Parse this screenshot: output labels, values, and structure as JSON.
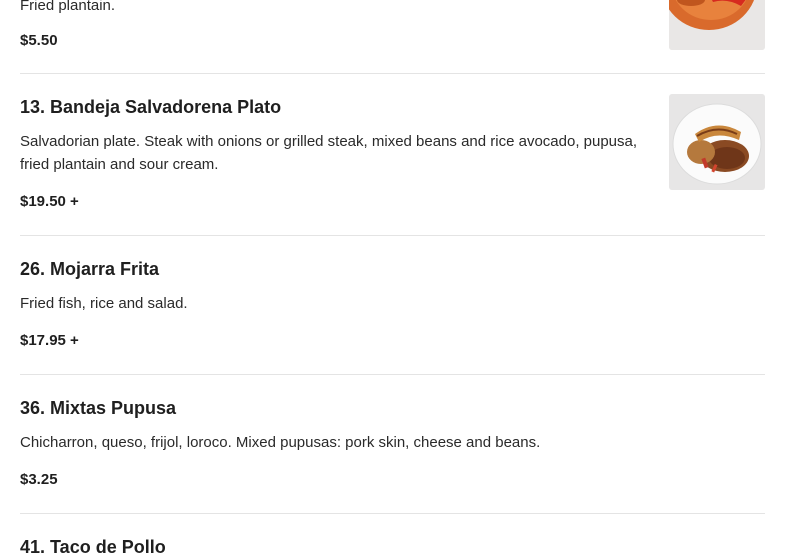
{
  "menu": {
    "items": [
      {
        "title": "",
        "description": "Fried plantain.",
        "price": "$5.50",
        "image": "plantain-dish-photo"
      },
      {
        "title": "13. Bandeja Salvadorena Plato",
        "description": "Salvadorian plate. Steak with onions or grilled steak, mixed beans and rice avocado, pupusa, fried plantain and sour cream.",
        "price": "$19.50 +",
        "image": "bandeja-plate-photo"
      },
      {
        "title": "26. Mojarra Frita",
        "description": "Fried fish, rice and salad.",
        "price": "$17.95 +"
      },
      {
        "title": "36. Mixtas Pupusa",
        "description": "Chicharron, queso, frijol, loroco. Mixed pupusas: pork skin, cheese and beans.",
        "price": "$3.25"
      },
      {
        "title": "41. Taco de Pollo",
        "description": "",
        "price": ""
      }
    ]
  }
}
